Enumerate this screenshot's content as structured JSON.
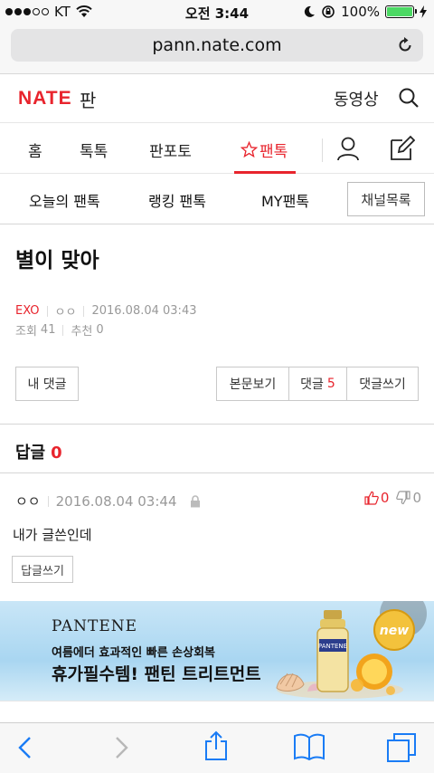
{
  "status_bar": {
    "carrier": "KT",
    "time": "오전 3:44",
    "battery": "100%",
    "signal_bars_filled": 3,
    "signal_bars_total": 5
  },
  "browser": {
    "url": "pann.nate.com"
  },
  "header": {
    "logo": "NATE",
    "logo_sub": "판",
    "video_link": "동영상"
  },
  "nav": {
    "items": [
      "홈",
      "톡톡",
      "판포토",
      "팬톡"
    ],
    "active_index": 3
  },
  "subnav": {
    "items": [
      "오늘의 팬톡",
      "랭킹 팬톡",
      "MY팬톡"
    ],
    "channel_button": "채널목록"
  },
  "article": {
    "title": "별이 맞아",
    "category": "EXO",
    "author": "ㅇㅇ",
    "datetime": "2016.08.04 03:43",
    "views_label": "조회",
    "views": "41",
    "recommend_label": "추천",
    "recommend": "0"
  },
  "buttons": {
    "my_comments": "내 댓글",
    "view_original": "본문보기",
    "comments_label": "댓글",
    "comments_count": "5",
    "write_comment": "댓글쓰기"
  },
  "replies": {
    "title": "답글",
    "count": "0"
  },
  "comment": {
    "author": "ㅇㅇ",
    "datetime": "2016.08.04 03:44",
    "text": "내가 글쓴인데",
    "up": "0",
    "down": "0",
    "reply_button": "답글쓰기"
  },
  "ad": {
    "brand": "PANTENE",
    "line1": "여름에더 효과적인 빠른 손상회복",
    "line2": "휴가필수템! 팬틴 트리트먼트",
    "badge": "new",
    "bottle_label": "PANTENE"
  },
  "colors": {
    "accent": "#e8242d",
    "muted": "#999999"
  }
}
